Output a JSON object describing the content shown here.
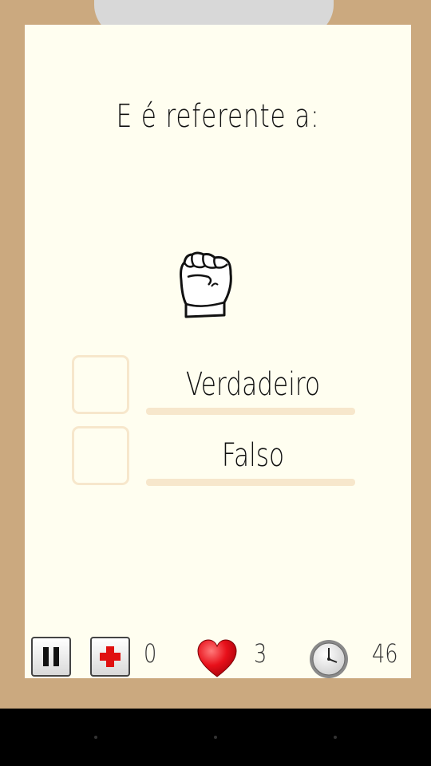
{
  "question": "E é referente a:",
  "sign_image": "fist-hand-sign",
  "options": [
    {
      "label": "Verdadeiro"
    },
    {
      "label": "Falso"
    }
  ],
  "status_bar": {
    "pause_icon": "pause-icon",
    "first_aid_icon": "first-aid-icon",
    "first_aid_count": "0",
    "heart_icon": "heart-icon",
    "lives": "3",
    "clock_icon": "clock-icon",
    "time": "46"
  },
  "colors": {
    "board": "#cba97f",
    "paper": "#fffef0",
    "option_outline": "#f7e7cc",
    "heart": "#e8101a"
  }
}
